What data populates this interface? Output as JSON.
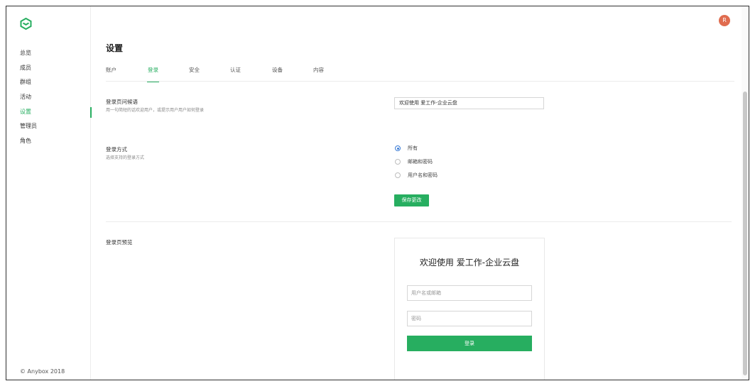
{
  "sidebar": {
    "logo_icon": "cube-logo-icon",
    "items": [
      {
        "label": "总览"
      },
      {
        "label": "成员"
      },
      {
        "label": "群组"
      },
      {
        "label": "活动"
      },
      {
        "label": "设置"
      },
      {
        "label": "管理员"
      },
      {
        "label": "角色"
      }
    ],
    "active_index": 4,
    "copyright": "© Anybox 2018"
  },
  "header": {
    "avatar_letter": "R",
    "avatar_color": "#e06c4f"
  },
  "page": {
    "title": "设置",
    "tabs": [
      {
        "label": "账户"
      },
      {
        "label": "登录"
      },
      {
        "label": "安全"
      },
      {
        "label": "认证"
      },
      {
        "label": "设备"
      },
      {
        "label": "内容"
      }
    ],
    "active_tab_index": 1
  },
  "greeting": {
    "label": "登录页问候语",
    "description": "用一句简短的话欢迎用户，或提示用户用户如何登录",
    "value": "欢迎使用 爱工作-企业云盘"
  },
  "login_method": {
    "label": "登录方式",
    "description": "选择支持的登录方式",
    "options": [
      {
        "label": "所有",
        "checked": true
      },
      {
        "label": "邮箱和密码",
        "checked": false
      },
      {
        "label": "用户名和密码",
        "checked": false
      }
    ],
    "save_label": "保存更改"
  },
  "preview": {
    "label": "登录页预览",
    "title": "欢迎使用 爱工作-企业云盘",
    "username_placeholder": "用户名或邮箱",
    "password_placeholder": "密码",
    "login_label": "登录"
  },
  "colors": {
    "accent": "#27ae60",
    "radio_selected": "#3a7bd5"
  }
}
